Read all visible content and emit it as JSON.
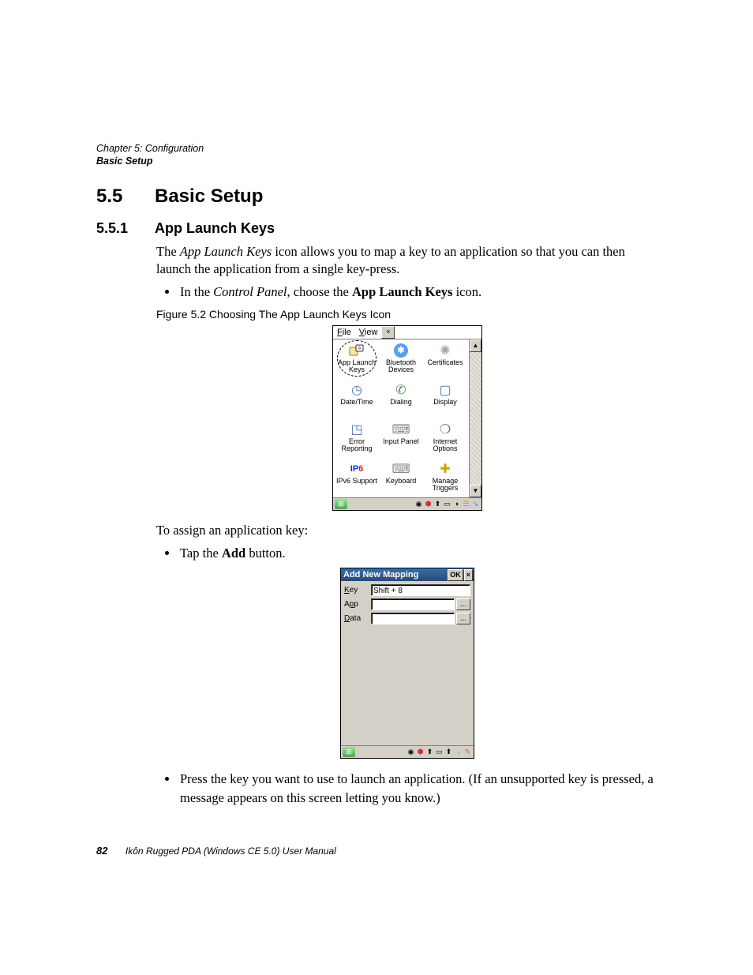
{
  "header": {
    "chapter": "Chapter 5: Configuration",
    "breadcrumb": "Basic Setup"
  },
  "section": {
    "number": "5.5",
    "title": "Basic Setup"
  },
  "subsection": {
    "number": "5.5.1",
    "title": "App Launch Keys"
  },
  "para1_pre": "The ",
  "para1_em": "App Launch Keys",
  "para1_post": " icon allows you to map a key to an application so that you can then launch the application from a single key-press.",
  "bullet1_pre": "In the ",
  "bullet1_em": "Control Panel",
  "bullet1_mid": ", choose the ",
  "bullet1_strong": "App Launch Keys",
  "bullet1_post": " icon.",
  "figcaption": "Figure 5.2  Choosing The App Launch Keys Icon",
  "cp_window": {
    "menu_file": "File",
    "menu_view": "View",
    "items": [
      {
        "label": "App Launch Keys"
      },
      {
        "label": "Bluetooth Devices"
      },
      {
        "label": "Certificates"
      },
      {
        "label": "Date/Time"
      },
      {
        "label": "Dialing"
      },
      {
        "label": "Display"
      },
      {
        "label": "Error Reporting"
      },
      {
        "label": "Input Panel"
      },
      {
        "label": "Internet Options"
      },
      {
        "label": "IPv6 Support"
      },
      {
        "label": "Keyboard"
      },
      {
        "label": "Manage Triggers"
      }
    ]
  },
  "para2": "To assign an application key:",
  "bullet2_pre": "Tap the ",
  "bullet2_strong": "Add",
  "bullet2_post": " button.",
  "dialog": {
    "title": "Add New Mapping",
    "ok": "OK",
    "close": "×",
    "key_label": "Key",
    "key_value": "Shift + 8",
    "app_label": "App",
    "app_value": "",
    "data_label": "Data",
    "data_value": "",
    "dots": "..."
  },
  "bullet3": "Press the key you want to use to launch an application. (If an unsupported key is pressed, a message appears on this screen letting you know.)",
  "footer": {
    "page": "82",
    "title": "Ikôn Rugged PDA (Windows CE 5.0) User Manual"
  }
}
